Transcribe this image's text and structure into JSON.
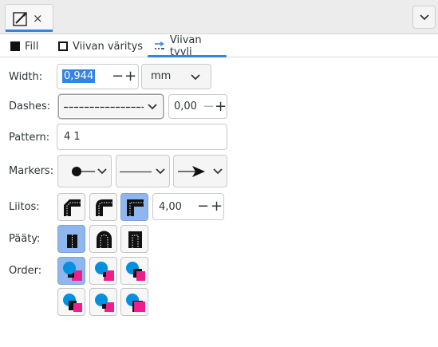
{
  "doc_tab": {
    "close_glyph": "×"
  },
  "tabs": [
    {
      "label": "Fill",
      "icon": "fill-square-icon"
    },
    {
      "label": "Viivan väritys",
      "icon": "stroke-square-icon"
    },
    {
      "label": "Viivan tyyli",
      "icon": "stroke-style-icon",
      "active": true
    }
  ],
  "width": {
    "label": "Width:",
    "value": "0,944",
    "unit": "mm"
  },
  "dashes": {
    "label": "Dashes:",
    "offset": "0,00"
  },
  "pattern": {
    "label": "Pattern:",
    "value": "4 1"
  },
  "markers": {
    "label": "Markers:"
  },
  "join": {
    "label": "Liitos:",
    "miter_limit": "4,00",
    "active_index": 2
  },
  "cap": {
    "label": "Pääty:",
    "active_index": 0
  },
  "order": {
    "label": "Order:",
    "active_index": 0
  },
  "colors": {
    "accent": "#3584e4",
    "active_button": "#8fb7ee",
    "cyan": "#0090e0",
    "magenta": "#f01e8c"
  }
}
